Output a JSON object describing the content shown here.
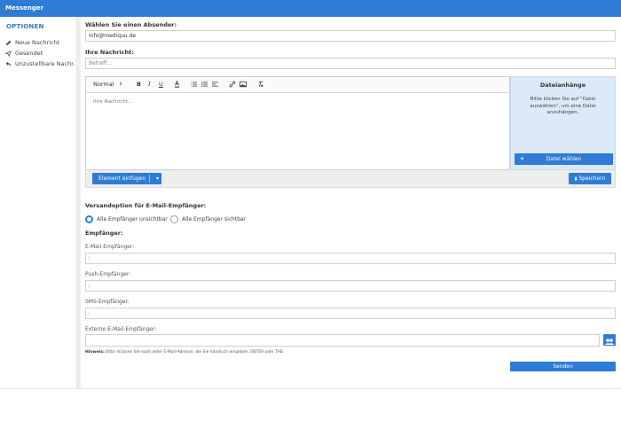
{
  "app": {
    "title": "Messenger"
  },
  "sidebar": {
    "title": "OPTIONEN",
    "items": [
      {
        "label": "Neue Nachricht",
        "icon": "pencil-icon"
      },
      {
        "label": "Gesendet",
        "icon": "send-icon"
      },
      {
        "label": "Unzustellbare Nachr.",
        "icon": "reply-icon"
      }
    ]
  },
  "sender": {
    "label": "Wählen Sie einen Absender:",
    "value": "info@mediquu.de"
  },
  "message": {
    "label": "Ihre Nachricht:",
    "subject_placeholder": "Betreff...",
    "body_placeholder": "Ihre Nachricht..."
  },
  "editor_toolbar": {
    "format_select": "Normal",
    "bold": "B",
    "italic": "I",
    "underline": "U"
  },
  "attachments": {
    "title": "Dateianhänge",
    "text": "Bitte klicken Sie auf \"Datei auswählen\", um eine Datei anzuhängen.",
    "button": "Datei wählen"
  },
  "actions": {
    "insert_element": "Element einfügen",
    "save": "Speichern",
    "send": "Senden"
  },
  "shipping": {
    "label": "Versandoption für E-Mail-Empfänger:",
    "options": [
      {
        "label": "Alle Empfänger unsichtbar",
        "selected": true
      },
      {
        "label": "Alle Empfänger sichtbar",
        "selected": false
      }
    ]
  },
  "recipients": {
    "label": "Empfänger:",
    "email_label": "E-Mail-Empfänger:",
    "push_label": "Push-Empfänger:",
    "sms_label": "SMS-Empfänger:",
    "external_label": "Externe E-Mail-Empfänger:",
    "hint_bold": "Hinweis:",
    "hint_text": " Bitte drücken Sie nach jeder E-Mail-Adresse, die Sie händisch eingeben, ENTER oder TAB."
  },
  "colors": {
    "primary": "#2e7cd6",
    "attachment_bg": "#dbe9f8"
  }
}
